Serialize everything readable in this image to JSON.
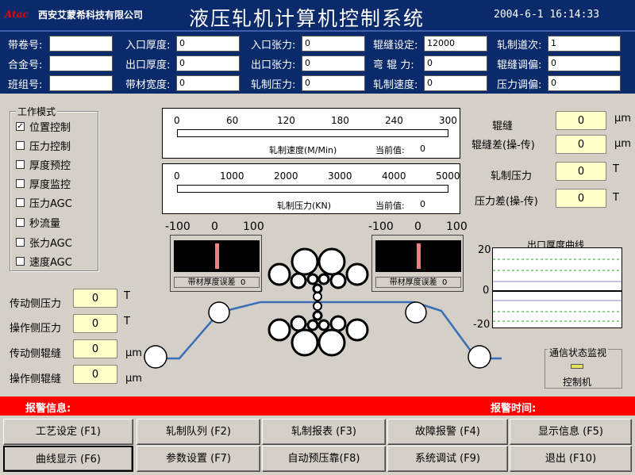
{
  "header": {
    "logo": "Atac",
    "company": "西安艾蒙希科技有限公司",
    "title": "液压轧机计算机控制系统",
    "datetime": "2004-6-1  16:14:33"
  },
  "params": {
    "col1": [
      {
        "label": "带卷号:",
        "value": ""
      },
      {
        "label": "合金号:",
        "value": ""
      },
      {
        "label": "班组号:",
        "value": ""
      }
    ],
    "col2": [
      {
        "label": "入口厚度:",
        "value": "0"
      },
      {
        "label": "出口厚度:",
        "value": "0"
      },
      {
        "label": "带材宽度:",
        "value": "0"
      }
    ],
    "col3": [
      {
        "label": "入口张力:",
        "value": "0"
      },
      {
        "label": "出口张力:",
        "value": "0"
      },
      {
        "label": "轧制压力:",
        "value": "0"
      }
    ],
    "col4": [
      {
        "label": "辊缝设定:",
        "value": "12000"
      },
      {
        "label": "弯 辊 力:",
        "value": "0"
      },
      {
        "label": "轧制速度:",
        "value": "0"
      }
    ],
    "col5": [
      {
        "label": "轧制道次:",
        "value": "1"
      },
      {
        "label": "辊缝调偏:",
        "value": "0"
      },
      {
        "label": "压力调偏:",
        "value": "0"
      }
    ]
  },
  "workmode": {
    "title": "工作模式",
    "items": [
      {
        "label": "位置控制",
        "checked": true
      },
      {
        "label": "压力控制",
        "checked": false
      },
      {
        "label": "厚度预控",
        "checked": false
      },
      {
        "label": "厚度监控",
        "checked": false
      },
      {
        "label": "压力AGC",
        "checked": false
      },
      {
        "label": "秒流量",
        "checked": false
      },
      {
        "label": "张力AGC",
        "checked": false
      },
      {
        "label": "速度AGC",
        "checked": false
      }
    ]
  },
  "speed_gauge": {
    "ticks": [
      "0",
      "60",
      "120",
      "180",
      "240",
      "300"
    ],
    "caption": "轧制速度(M/Min)",
    "current_label": "当前值:",
    "current_value": "0"
  },
  "force_gauge": {
    "ticks": [
      "0",
      "1000",
      "2000",
      "3000",
      "4000",
      "5000"
    ],
    "caption": "轧制压力(KN)",
    "current_label": "当前值:",
    "current_value": "0"
  },
  "right_readouts": [
    {
      "label": "辊缝",
      "value": "0",
      "unit": "μm"
    },
    {
      "label": "辊缝差(操-传)",
      "value": "0",
      "unit": "μm"
    },
    {
      "label": "轧制压力",
      "value": "0",
      "unit": "T"
    },
    {
      "label": "压力差(操-传)",
      "value": "0",
      "unit": "T"
    }
  ],
  "left_readouts": [
    {
      "label": "传动侧压力",
      "value": "0",
      "unit": "T"
    },
    {
      "label": "操作侧压力",
      "value": "0",
      "unit": "T"
    },
    {
      "label": "传动侧辊缝",
      "value": "0",
      "unit": "μm"
    },
    {
      "label": "操作侧辊缝",
      "value": "0",
      "unit": "μm"
    }
  ],
  "meters": {
    "ticks": [
      "-100",
      "0",
      "100"
    ],
    "left": {
      "label": "带材厚度误差",
      "value": "0"
    },
    "right": {
      "label": "带材厚度误差",
      "value": "0"
    }
  },
  "curve": {
    "title": "出口厚度曲线",
    "ticks": [
      "20",
      "0",
      "-20"
    ]
  },
  "comm": {
    "title": "通信状态监视",
    "label": "控制机"
  },
  "alarm": {
    "info_label": "报警信息:",
    "time_label": "报警时间:"
  },
  "buttons": [
    {
      "label": "工艺设定 (F1)"
    },
    {
      "label": "轧制队列 (F2)"
    },
    {
      "label": "轧制报表 (F3)"
    },
    {
      "label": "故障报警 (F4)"
    },
    {
      "label": "显示信息 (F5)"
    },
    {
      "label": "曲线显示 (F6)"
    },
    {
      "label": "参数设置 (F7)"
    },
    {
      "label": "自动预压靠(F8)"
    },
    {
      "label": "系统调试 (F9)"
    },
    {
      "label": "退出 (F10)"
    }
  ],
  "colors": {
    "header_bg": "#0a2a6b",
    "alarm_bg": "#ff0000",
    "readout_bg": "#ffffc8",
    "strip": "#3a6fb8"
  }
}
